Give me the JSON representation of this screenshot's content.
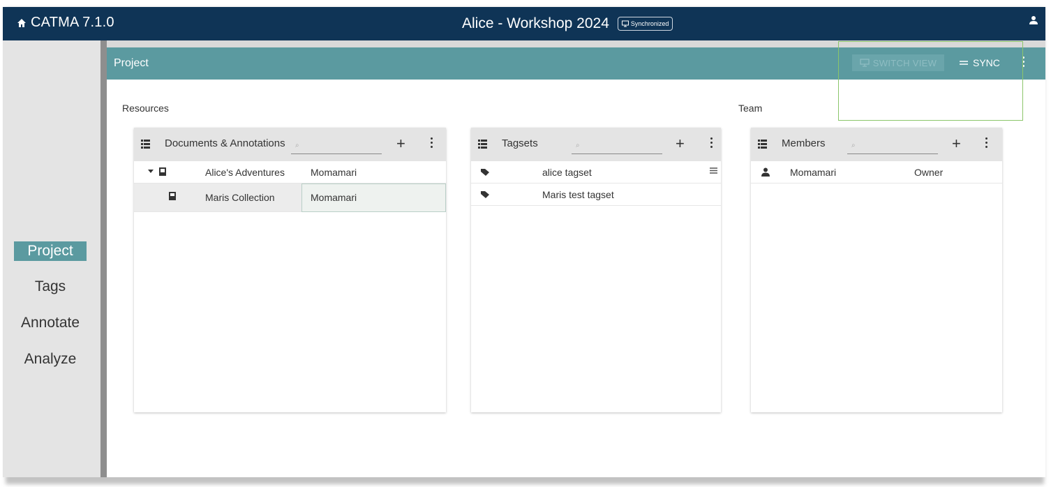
{
  "app": {
    "brand": "CATMA 7.1.0",
    "project_title": "Alice - Workshop 2024",
    "sync_status": "Synchronized"
  },
  "nav": {
    "items": [
      "Project",
      "Tags",
      "Annotate",
      "Analyze"
    ],
    "active": "Project"
  },
  "project_bar": {
    "title": "Project",
    "switch_view": "SWITCH VIEW",
    "sync": "SYNC"
  },
  "sections": {
    "resources": "Resources",
    "team": "Team"
  },
  "documents": {
    "title": "Documents & Annotations",
    "rows": [
      {
        "name": "Alice's Adventures",
        "owner": "Momamari"
      },
      {
        "name": "Maris Collection",
        "owner": "Momamari"
      }
    ]
  },
  "tagsets": {
    "title": "Tagsets",
    "rows": [
      {
        "name": "alice tagset"
      },
      {
        "name": "Maris test tagset"
      }
    ]
  },
  "members": {
    "title": "Members",
    "rows": [
      {
        "name": "Momamari",
        "role": "Owner"
      }
    ]
  },
  "colors": {
    "header": "#0f3456",
    "accent": "#5b9aa0",
    "highlight": "#8bc56a"
  }
}
